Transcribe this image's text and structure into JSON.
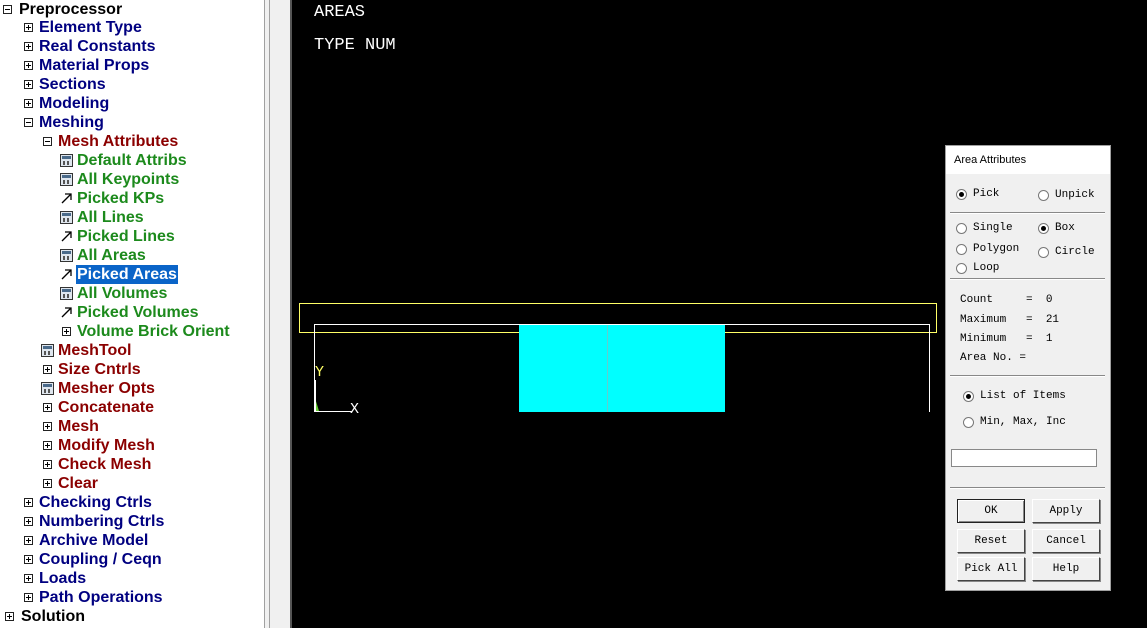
{
  "tree": {
    "root": "Preprocessor",
    "items": [
      {
        "label": "Element Type",
        "color": "#000080"
      },
      {
        "label": "Real Constants",
        "color": "#000080"
      },
      {
        "label": "Material Props",
        "color": "#000080"
      },
      {
        "label": "Sections",
        "color": "#000080"
      },
      {
        "label": "Modeling",
        "color": "#000080"
      },
      {
        "label": "Meshing",
        "color": "#000080"
      },
      {
        "label": "Mesh Attributes",
        "color": "#8b0000"
      },
      {
        "label": "Default Attribs",
        "color": "#1c8a1c"
      },
      {
        "label": "All Keypoints",
        "color": "#1c8a1c"
      },
      {
        "label": "Picked KPs",
        "color": "#1c8a1c"
      },
      {
        "label": "All Lines",
        "color": "#1c8a1c"
      },
      {
        "label": "Picked Lines",
        "color": "#1c8a1c"
      },
      {
        "label": "All Areas",
        "color": "#1c8a1c"
      },
      {
        "label": "Picked Areas",
        "color": "#1c8a1c",
        "selected": true
      },
      {
        "label": "All Volumes",
        "color": "#1c8a1c"
      },
      {
        "label": "Picked Volumes",
        "color": "#1c8a1c"
      },
      {
        "label": "Volume Brick Orient",
        "color": "#1c8a1c"
      },
      {
        "label": "MeshTool",
        "color": "#8b0000"
      },
      {
        "label": "Size Cntrls",
        "color": "#8b0000"
      },
      {
        "label": "Mesher Opts",
        "color": "#8b0000"
      },
      {
        "label": "Concatenate",
        "color": "#8b0000"
      },
      {
        "label": "Mesh",
        "color": "#8b0000"
      },
      {
        "label": "Modify Mesh",
        "color": "#8b0000"
      },
      {
        "label": "Check Mesh",
        "color": "#8b0000"
      },
      {
        "label": "Clear",
        "color": "#8b0000"
      },
      {
        "label": "Checking Ctrls",
        "color": "#000080"
      },
      {
        "label": "Numbering Ctrls",
        "color": "#000080"
      },
      {
        "label": "Archive Model",
        "color": "#000080"
      },
      {
        "label": "Coupling / Ceqn",
        "color": "#000080"
      },
      {
        "label": "Loads",
        "color": "#000080"
      },
      {
        "label": "Path Operations",
        "color": "#000080"
      }
    ],
    "solution": "Solution"
  },
  "graphics": {
    "title_line1": "AREAS",
    "title_line2": "TYPE NUM",
    "axis_y": "Y",
    "axis_x": "X",
    "area_color": "#00ffff",
    "outline_color": "#ffff66",
    "background": "#000000"
  },
  "dialog": {
    "title": "Area Attributes",
    "pick": "Pick",
    "unpick": "Unpick",
    "pick_selected": true,
    "single": "Single",
    "box": "Box",
    "polygon": "Polygon",
    "circle": "Circle",
    "loop": "Loop",
    "mode_selected": "Box",
    "count_label": "Count",
    "count": "0",
    "maximum_label": "Maximum",
    "maximum": "21",
    "minimum_label": "Minimum",
    "minimum": "1",
    "area_no_label": "Area No.",
    "area_no": "",
    "list_of_items": "List of Items",
    "min_max_inc": "Min, Max, Inc",
    "list_selected": "List of Items",
    "input_value": "",
    "ok": "OK",
    "apply": "Apply",
    "reset": "Reset",
    "cancel": "Cancel",
    "pick_all": "Pick All",
    "help": "Help"
  }
}
